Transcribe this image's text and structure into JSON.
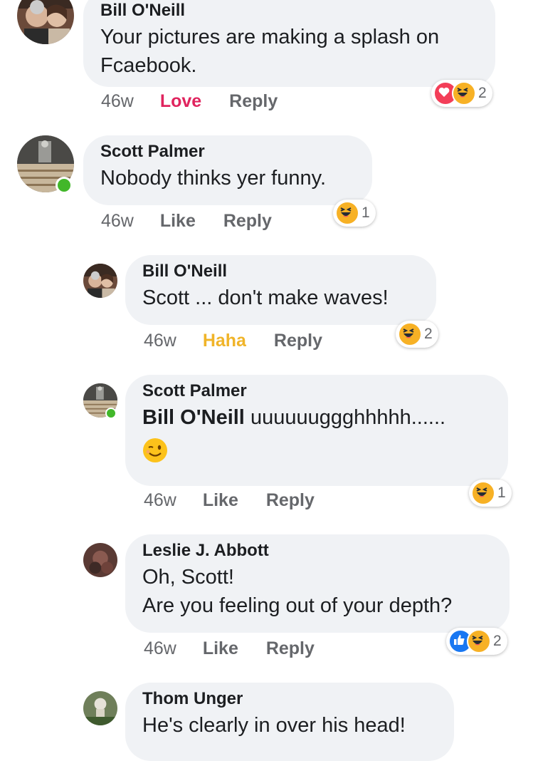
{
  "comments": [
    {
      "author": "Bill O'Neill",
      "text": "Your pictures are making a splash on Fcaebook.",
      "time": "46w",
      "action_label": "Love",
      "reply_label": "Reply",
      "reaction_count": "2",
      "reactions": [
        "love-icon",
        "haha-icon"
      ],
      "action_color": "#e0245e"
    },
    {
      "author": "Scott Palmer",
      "text": "Nobody thinks yer funny.",
      "time": "46w",
      "action_label": "Like",
      "reply_label": "Reply",
      "reaction_count": "1",
      "reactions": [
        "haha-icon"
      ],
      "online": true
    },
    {
      "author": "Bill O'Neill",
      "text": "Scott ... don't make waves!",
      "time": "46w",
      "action_label": "Haha",
      "reply_label": "Reply",
      "reaction_count": "2",
      "reactions": [
        "haha-icon"
      ],
      "action_color": "#f0b429"
    },
    {
      "author": "Scott Palmer",
      "mention": "Bill O'Neill",
      "text": "uuuuuuggghhhhh......",
      "emoji": "winking-face-emoji",
      "time": "46w",
      "action_label": "Like",
      "reply_label": "Reply",
      "reaction_count": "1",
      "reactions": [
        "haha-icon"
      ],
      "online": true
    },
    {
      "author": "Leslie J. Abbott",
      "text_line1": "Oh, Scott!",
      "text_line2": "Are you feeling out of your depth?",
      "time": "46w",
      "action_label": "Like",
      "reply_label": "Reply",
      "reaction_count": "2",
      "reactions": [
        "like-icon",
        "haha-icon"
      ]
    },
    {
      "author": "Thom Unger",
      "text": "He's clearly in over his head!"
    }
  ],
  "colors": {
    "bubble": "#f0f2f5",
    "muted": "#65676b",
    "love": "#e0245e",
    "haha": "#f0b429",
    "like": "#1877f2",
    "online": "#42b72a"
  }
}
